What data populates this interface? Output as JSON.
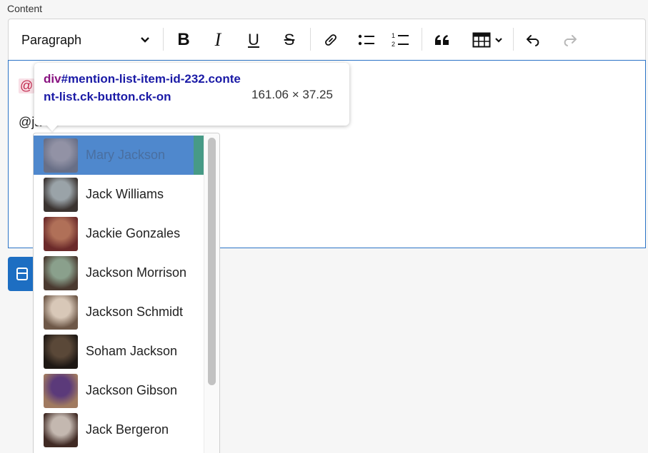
{
  "field_label": "Content",
  "toolbar": {
    "heading_select": "Paragraph",
    "icons": [
      "bold-icon",
      "italic-icon",
      "underline-icon",
      "strikethrough-icon",
      "link-icon",
      "bulleted-list-icon",
      "numbered-list-icon",
      "blockquote-icon",
      "table-icon",
      "undo-icon",
      "redo-icon"
    ],
    "bold_glyph": "B",
    "italic_glyph": "I",
    "underline_glyph": "U",
    "strike_glyph": "S"
  },
  "editor": {
    "mention_chip": "@",
    "typing_text": "@ja"
  },
  "inspector_tooltip": {
    "selector_tag": "div",
    "selector_rest": "#mention-list-item-id-232.content-list.ck-button.ck-on",
    "dimensions": "161.06 × 37.25"
  },
  "mention_list": {
    "items": [
      {
        "name": "Mary Jackson",
        "active": true,
        "avatar_colors": [
          "#c89a84",
          "#7d5a4c"
        ]
      },
      {
        "name": "Jack Williams",
        "active": false,
        "avatar_colors": [
          "#9aa3a8",
          "#3a3330"
        ]
      },
      {
        "name": "Jackie Gonzales",
        "active": false,
        "avatar_colors": [
          "#b07058",
          "#6b2a2a"
        ]
      },
      {
        "name": "Jackson Morrison",
        "active": false,
        "avatar_colors": [
          "#8aa08c",
          "#4a3a30"
        ]
      },
      {
        "name": "Jackson Schmidt",
        "active": false,
        "avatar_colors": [
          "#d8c8b8",
          "#6e5848"
        ]
      },
      {
        "name": "Soham Jackson",
        "active": false,
        "avatar_colors": [
          "#5a4838",
          "#1e1814"
        ]
      },
      {
        "name": "Jackson Gibson",
        "active": false,
        "avatar_colors": [
          "#5b3a7a",
          "#a07a60"
        ]
      },
      {
        "name": "Jack Bergeron",
        "active": false,
        "avatar_colors": [
          "#c4b8b0",
          "#402a24"
        ]
      }
    ]
  },
  "colors": {
    "accent": "#2b73c6",
    "mention_text": "#c1264b",
    "mention_bg": "#f8dfe6",
    "active_item_bg": "#4f88cd",
    "save_button": "#1d6ec2"
  }
}
